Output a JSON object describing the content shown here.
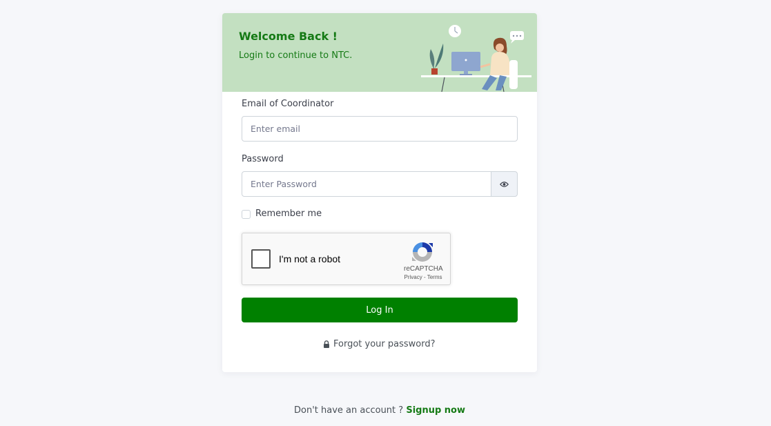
{
  "banner": {
    "title": "Welcome Back !",
    "subtitle": "Login to continue to NTC."
  },
  "form": {
    "email_label": "Email of Coordinator",
    "email_placeholder": "Enter email",
    "email_value": "",
    "password_label": "Password",
    "password_placeholder": "Enter Password",
    "password_value": "",
    "remember_label": "Remember me",
    "remember_checked": false,
    "login_label": "Log In",
    "forgot_label": "Forgot your password?"
  },
  "captcha": {
    "label": "I'm not a robot",
    "brand": "reCAPTCHA",
    "links": "Privacy - Terms",
    "checked": false
  },
  "footer": {
    "prompt": "Don't have an account ?",
    "signup_label": "Signup now"
  },
  "icons": {
    "eye": "eye-icon",
    "lock": "lock-icon",
    "recaptcha": "recaptcha-logo-icon"
  },
  "colors": {
    "brand_green": "#008000",
    "banner_bg": "#c3e0c1",
    "banner_text": "#157a15",
    "page_bg": "#f6f7fa"
  }
}
